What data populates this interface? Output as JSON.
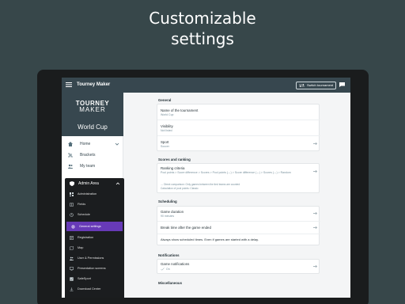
{
  "hero": {
    "line1": "Customizable",
    "line2": "settings"
  },
  "appbar": {
    "title": "Tourney Maker",
    "switch_label": "Switch tournament"
  },
  "brand": {
    "line1": "TOURNEY",
    "line2": "MAKER",
    "event": "World Cup"
  },
  "nav": [
    {
      "label": "Home",
      "icon": "home-icon"
    },
    {
      "label": "Brackets",
      "icon": "brackets-icon"
    },
    {
      "label": "My team",
      "icon": "team-icon"
    }
  ],
  "admin": {
    "title": "Admin Area",
    "items": [
      {
        "label": "Administration"
      },
      {
        "label": "Fields"
      },
      {
        "label": "Schedule"
      },
      {
        "label": "General settings"
      },
      {
        "label": "Registration"
      },
      {
        "label": "Map"
      },
      {
        "label": "User & Permissions"
      },
      {
        "label": "Presentation screens"
      },
      {
        "label": "SafeSport"
      },
      {
        "label": "Download Center"
      }
    ]
  },
  "general": {
    "title": "General",
    "name_label": "Name of the tournament",
    "name_value": "World Cup",
    "visibility_label": "Visibility",
    "visibility_value": "Not listed",
    "sport_label": "Sport",
    "sport_value": "Soccer"
  },
  "scores": {
    "title": "Scores and ranking",
    "criteria_label": "Ranking criteria",
    "criteria_value": "Pool points > Score difference > Scores > Pool points (↔) > Score difference (↔) > Scores (↔) > Random",
    "note1": "↔ Direct comparison: Only games between the tied teams are counted",
    "note2": "Calculation of pool points: Classic"
  },
  "scheduling": {
    "title": "Scheduling",
    "duration_label": "Game duration",
    "duration_value": "90 minutes",
    "break_label": "Break time after the game ended",
    "always_label": "Always show scheduled times. Even if games are started with a delay."
  },
  "notifications": {
    "title": "Notifications",
    "game_label": "Game notifications",
    "game_value": "On"
  },
  "misc": {
    "title": "Miscellaneous"
  },
  "colors": {
    "appbar": "#37474f",
    "accent": "#673ab7",
    "background": "#37474a"
  }
}
